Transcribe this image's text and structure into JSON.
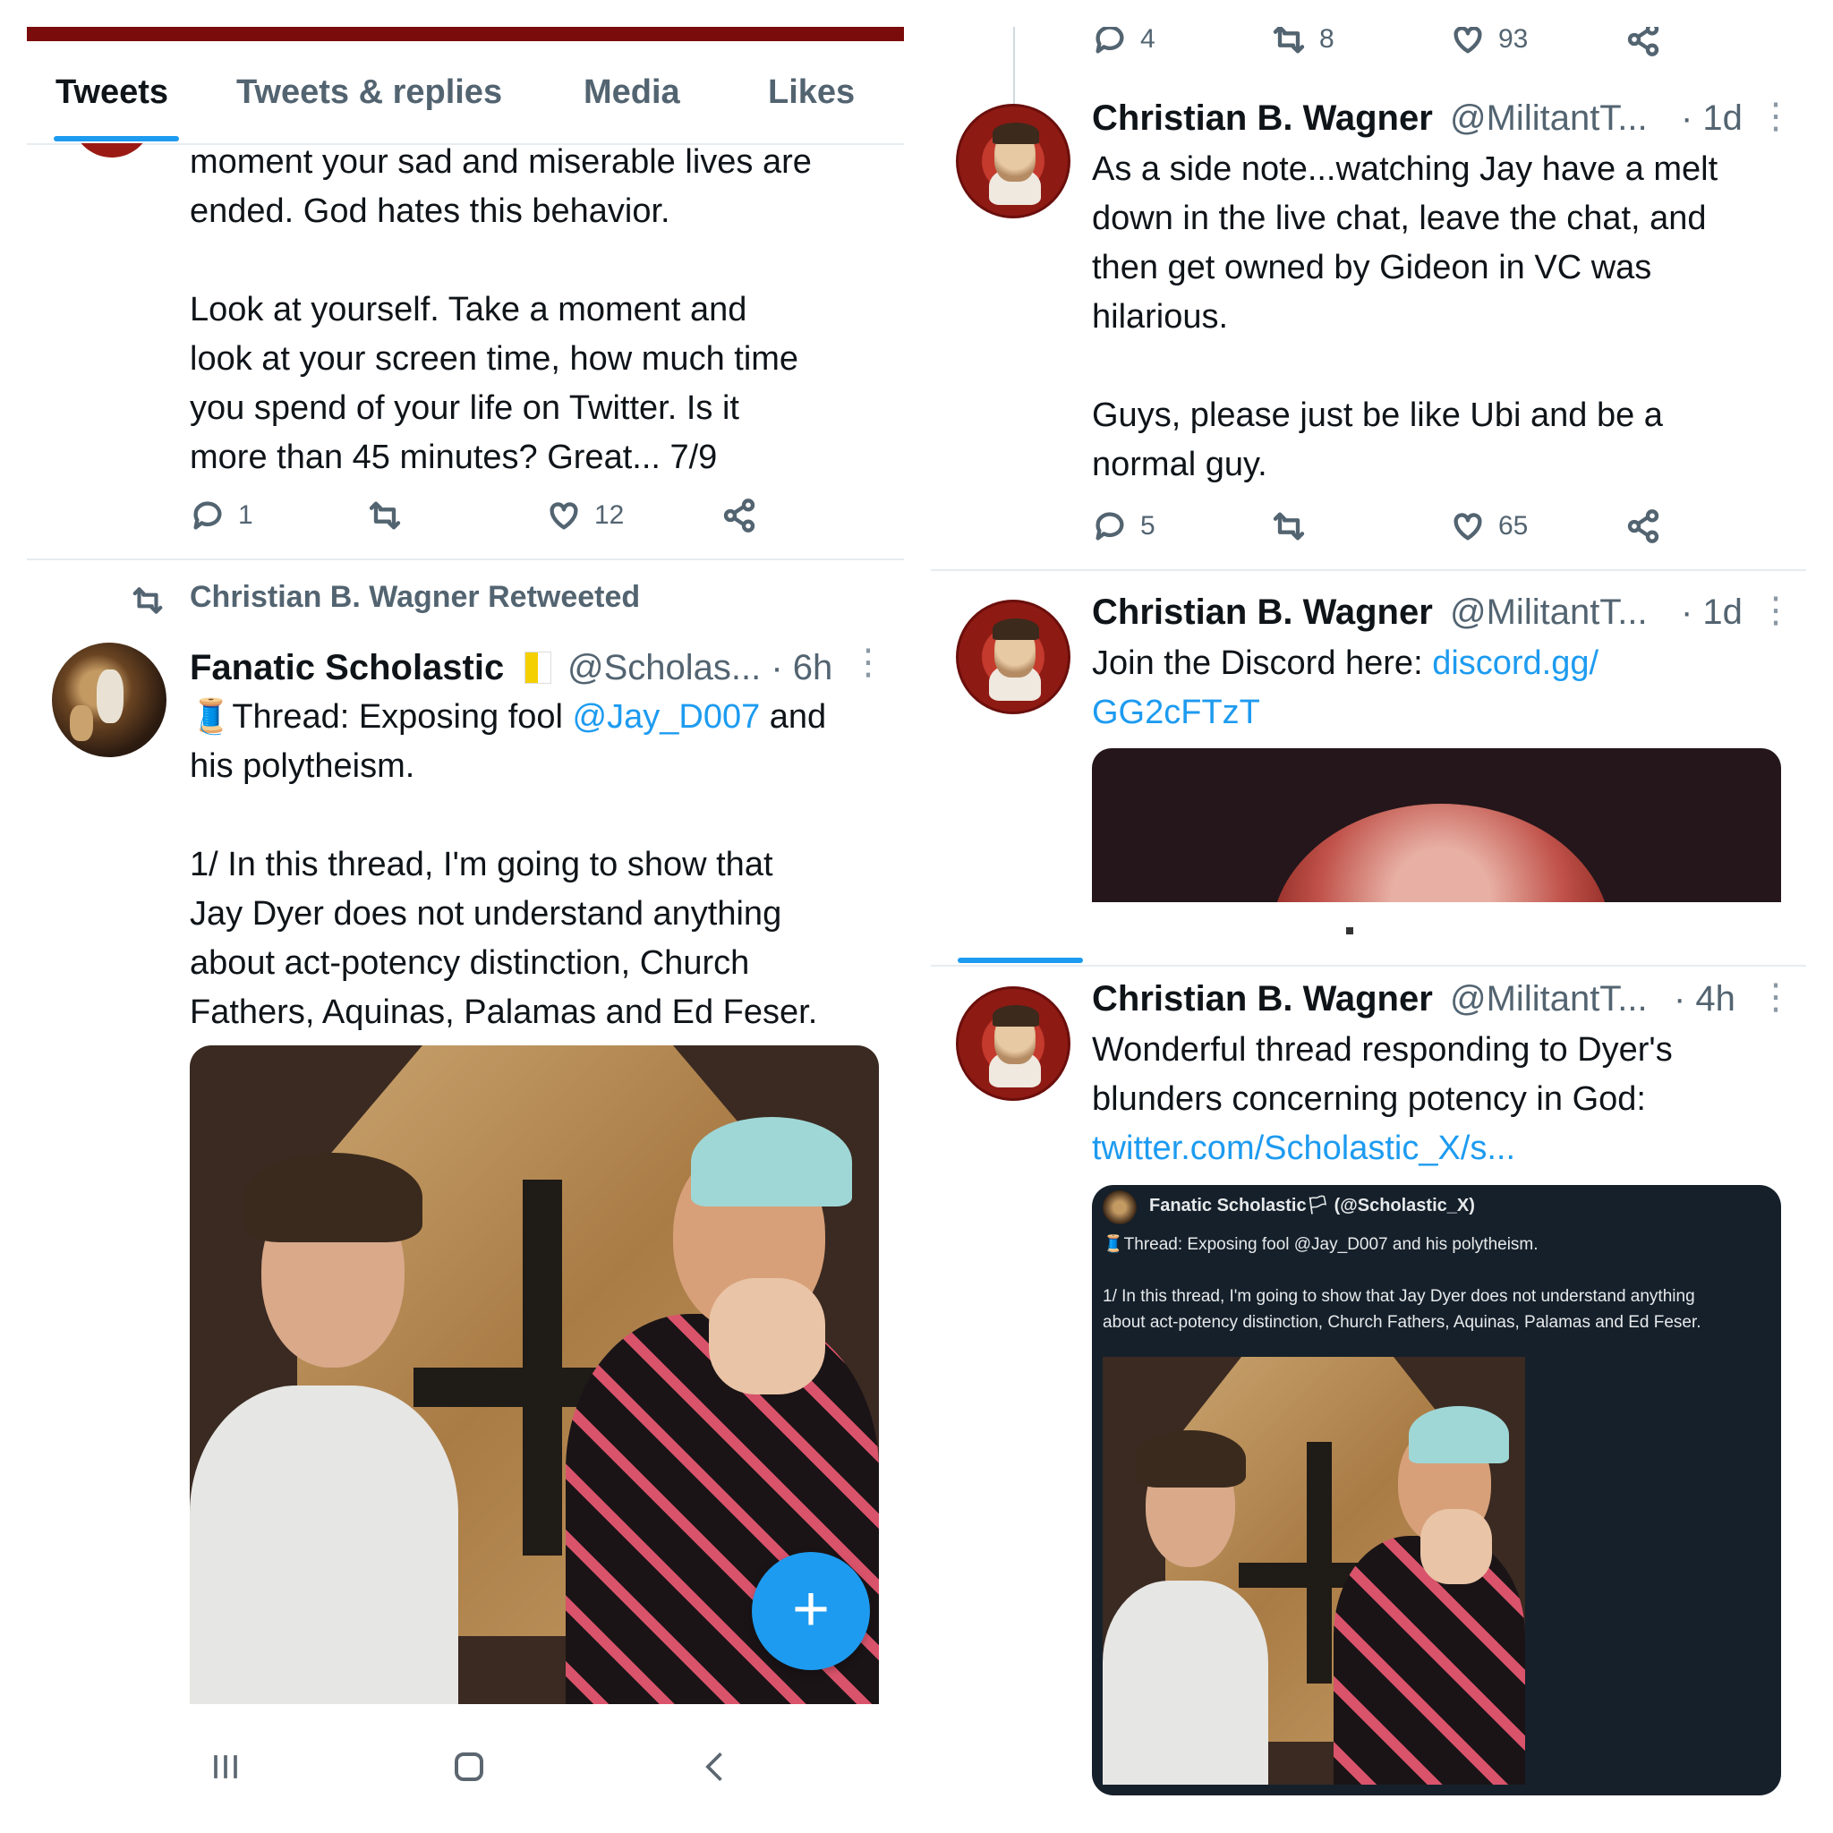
{
  "left": {
    "tabs": [
      "Tweets",
      "Tweets & replies",
      "Media",
      "Likes"
    ],
    "tweet1": {
      "text": "moment your sad and miserable lives are\nended. God hates this behavior.\n\nLook at yourself. Take a moment and\nlook at your screen time, how much time\nyou spend of your life on Twitter. Is it\nmore than 45 minutes? Great... 7/9",
      "replies": "1",
      "likes": "12"
    },
    "retweet_label": "Christian B. Wagner Retweeted",
    "tweet2": {
      "name": "Fanatic Scholastic",
      "handle_time": "@Scholas... · 6h",
      "text_prefix": "🧵Thread: Exposing fool ",
      "mention": "@Jay_D007",
      "text_suffix": " and\nhis polytheism.\n\n1/ In this thread, I'm going to show that\nJay Dyer does not understand anything\nabout act-potency distinction, Church\nFathers, Aquinas, Palamas and Ed Feser."
    },
    "fab_label": "+",
    "nav": [
      "menu-lines",
      "home-square",
      "back-chevron"
    ]
  },
  "right": {
    "top_actions": {
      "replies": "4",
      "retweets": "8",
      "likes": "93"
    },
    "tweet1": {
      "name": "Christian B. Wagner",
      "handle": "@MilitantT...",
      "time": "· 1d",
      "text": "As a side note...watching Jay have a melt\ndown in the live chat, leave the chat, and\nthen get owned by Gideon in VC was\nhilarious.\n\nGuys, please just be like Ubi and be a\nnormal guy.",
      "replies": "5",
      "likes": "65"
    },
    "tweet2": {
      "name": "Christian B. Wagner",
      "handle": "@MilitantT...",
      "time": "· 1d",
      "text_prefix": "Join the Discord here: ",
      "link": "discord.gg/\nGG2cFTzT"
    },
    "tweet3": {
      "name": "Christian B. Wagner",
      "handle": "@MilitantT...",
      "time": "· 4h",
      "text": "Wonderful thread responding to Dyer's\nblunders concerning potency in God:",
      "link": "twitter.com/Scholastic_X/s..."
    },
    "quote": {
      "header": "Fanatic Scholastic🏳 (@Scholastic_X)",
      "line1": "🧵Thread: Exposing fool @Jay_D007 and his polytheism.",
      "line2": "1/ In this thread, I'm going to show that Jay Dyer does not understand anything\nabout act-potency distinction, Church Fathers, Aquinas, Palamas and Ed Feser."
    }
  },
  "colors": {
    "accent": "#1d9bf0",
    "text": "#0f1419",
    "muted": "#536471",
    "header_bar": "#7a0c0c",
    "dark_card": "#15202b"
  },
  "icons": [
    "reply-icon",
    "retweet-icon",
    "like-icon",
    "share-icon",
    "more-icon",
    "plus-icon"
  ]
}
